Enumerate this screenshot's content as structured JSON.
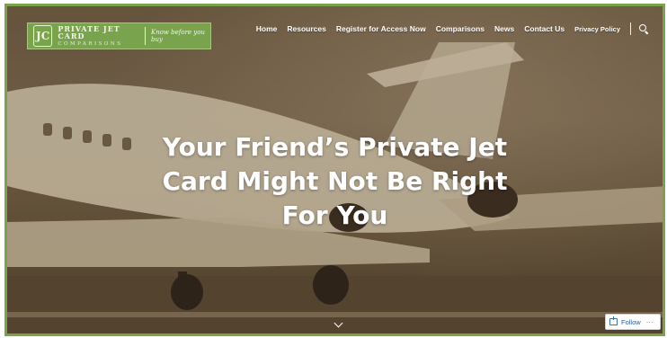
{
  "logo": {
    "title": "PRIVATE JET CARD",
    "subtitle": "COMPARISONS",
    "tagline": "Know before you buy",
    "mark": "JC"
  },
  "nav": {
    "items": [
      {
        "label": "Home"
      },
      {
        "label": "Resources"
      },
      {
        "label": "Register for Access Now"
      },
      {
        "label": "Comparisons"
      },
      {
        "label": "News"
      },
      {
        "label": "Contact Us"
      },
      {
        "label": "Privacy Policy"
      }
    ],
    "search_icon": "search-icon"
  },
  "hero": {
    "headline_lines": [
      "Your Friend’s Private Jet",
      "Card Might Not Be Right",
      "For You"
    ],
    "scroll_icon": "chevron-down-icon"
  },
  "follow": {
    "label": "Follow",
    "more": "···"
  },
  "colors": {
    "brand_green": "#79a34c",
    "frame_border": "#7aa24d"
  }
}
